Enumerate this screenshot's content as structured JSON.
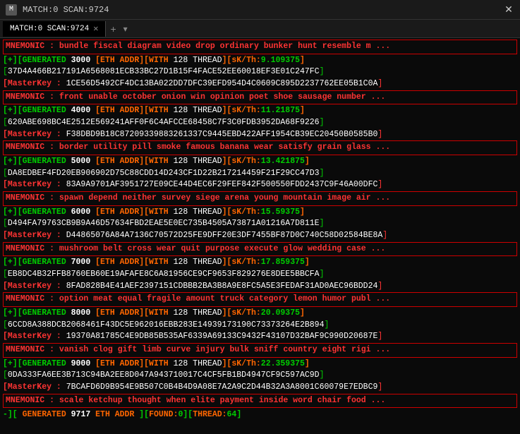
{
  "titlebar": {
    "icon": "M",
    "title": "MATCH:0 SCAN:9724",
    "close_label": "✕",
    "new_tab_label": "+",
    "dropdown_label": "▾"
  },
  "tab": {
    "label": "MATCH:0 SCAN:9724"
  },
  "lines": [
    {
      "type": "mnemonic",
      "text": "MNEMONIC : bundle fiscal diagram video drop ordinary bunker hunt resemble m ..."
    },
    {
      "type": "generated",
      "prefix": "[+][GENERATED",
      "num": "3000",
      "eth": "ETH ADDR][WITH",
      "thread": "128 THREAD",
      "sk": "sK/Th:",
      "skval": "9.109375",
      "suffix": "]"
    },
    {
      "type": "addr",
      "text": "37D4A466B217191A6568081ECB33BC27D1B15F4FACE52EE60018EF3E01C247FC"
    },
    {
      "type": "masterkey",
      "label": "MasterKey",
      "value": "1CE56D5492CF4DC13BA022DD7DFC39EFD954D4C0609C895D2237762EE05B1C0A"
    },
    {
      "type": "mnemonic",
      "text": "MNEMONIC : front unable october onion win opinion poet shoe sausage number ..."
    },
    {
      "type": "generated",
      "prefix": "[+][GENERATED",
      "num": "4000",
      "eth": "ETH ADDR][WITH",
      "thread": "128 THREAD",
      "sk": "sK/Th:",
      "skval": "11.21875",
      "suffix": "]"
    },
    {
      "type": "addr",
      "text": "620ABE698BC4E2512E569241AFF0F6C4AFCCE68458C7F3C0FDB3952DA68F9226"
    },
    {
      "type": "masterkey",
      "label": "MasterKey",
      "value": "F38DBD9B18C87209339883261337C9445EBD422AFF1954CB39EC20450B0585B0"
    },
    {
      "type": "mnemonic",
      "text": "MNEMONIC : border utility pill smoke famous banana wear satisfy grain glass ..."
    },
    {
      "type": "generated",
      "prefix": "[+][GENERATED",
      "num": "5000",
      "eth": "ETH ADDR][WITH",
      "thread": "128 THREAD",
      "sk": "sK/Th:",
      "skval": "13.421875",
      "suffix": "]"
    },
    {
      "type": "addr",
      "text": "DA8EDBEF4FD20EB906902D75C88CDD14D243CF1D22B217214459F21F29CC47D3"
    },
    {
      "type": "masterkey",
      "label": "MasterKey",
      "value": "83A9A9701AF3951727E09CE44D4EC6F29FEF842F500550FDD2437C9F46A00DFC"
    },
    {
      "type": "mnemonic",
      "text": "MNEMONIC : spawn depend neither survey siege arena young mountain image air ..."
    },
    {
      "type": "generated",
      "prefix": "[+][GENERATED",
      "num": "6000",
      "eth": "ETH ADDR][WITH",
      "thread": "128 THREAD",
      "sk": "sK/Th:",
      "skval": "15.59375",
      "suffix": "]"
    },
    {
      "type": "addr",
      "text": "D494FA79763CB9B9A46D57634FBD2EAE5E0EC735B4505A73871A01216A7D811E"
    },
    {
      "type": "masterkey",
      "label": "MasterKey",
      "value": "D44865076A84A7136C70572D25FE9DFF20E3DF7455BF87D0C740C58D02584BE8A"
    },
    {
      "type": "mnemonic",
      "text": "MNEMONIC : mushroom belt cross wear quit purpose execute glow wedding case ..."
    },
    {
      "type": "generated",
      "prefix": "[+][GENERATED",
      "num": "7000",
      "eth": "ETH ADDR][WITH",
      "thread": "128 THREAD",
      "sk": "sK/Th:",
      "skval": "17.859375",
      "suffix": "]"
    },
    {
      "type": "addr",
      "text": "EB8DC4B32FFB8760EB60E19AFAFE8C6A81956CE9CF9653F829276E8DEE5BBCFA"
    },
    {
      "type": "masterkey",
      "label": "MasterKey",
      "value": "8FAD828B4E41AEF2397151CDBBB2BA3B8A9E8FC5A5E3FEDAF31AD0AEC96BDD24"
    },
    {
      "type": "mnemonic",
      "text": "MNEMONIC : option meat equal fragile amount truck category lemon humor publ ..."
    },
    {
      "type": "generated",
      "prefix": "[+][GENERATED",
      "num": "8000",
      "eth": "ETH ADDR][WITH",
      "thread": "128 THREAD",
      "sk": "sK/Th:",
      "skval": "20.09375",
      "suffix": "]"
    },
    {
      "type": "addr",
      "text": "6CCD8A388DCB2068461F43DC5E962016EBB283E14939173190C73373264E2B894"
    },
    {
      "type": "masterkey",
      "label": "MasterKey",
      "value": "19370A81785C4E9DB85B535AF6339A69133C9432F43107D32BAF9C990D20687E"
    },
    {
      "type": "mnemonic",
      "text": "MNEMONIC : vanish clog gift limb curve injury bulk sniff country eight rigi ..."
    },
    {
      "type": "generated",
      "prefix": "[+][GENERATED",
      "num": "9000",
      "eth": "ETH ADDR][WITH",
      "thread": "128 THREAD",
      "sk": "sK/Th:",
      "skval": "22.359375",
      "suffix": "]"
    },
    {
      "type": "addr",
      "text": "0DA333FA6EE3B713C94BA2EE8D047A943710017C4CF5FB1BD4947CF9C597AC9D"
    },
    {
      "type": "masterkey",
      "label": "MasterKey",
      "value": "7BCAFD6D9B954E9B507C0B4B4D9A08E7A2A9C2D44B32A3A8001C60079E7EDBC9"
    },
    {
      "type": "mnemonic",
      "text": "MNEMONIC : scale ketchup thought when elite payment inside word chair food ..."
    },
    {
      "type": "status",
      "text": "-][ GENERATED 9717 ETH ADDR ][FOUND:0][THREAD:64"
    }
  ],
  "colors": {
    "red": "#ff3333",
    "green": "#00cc00",
    "orange": "#ff6600",
    "white": "#ffffff",
    "bg": "#0a0a0a"
  }
}
